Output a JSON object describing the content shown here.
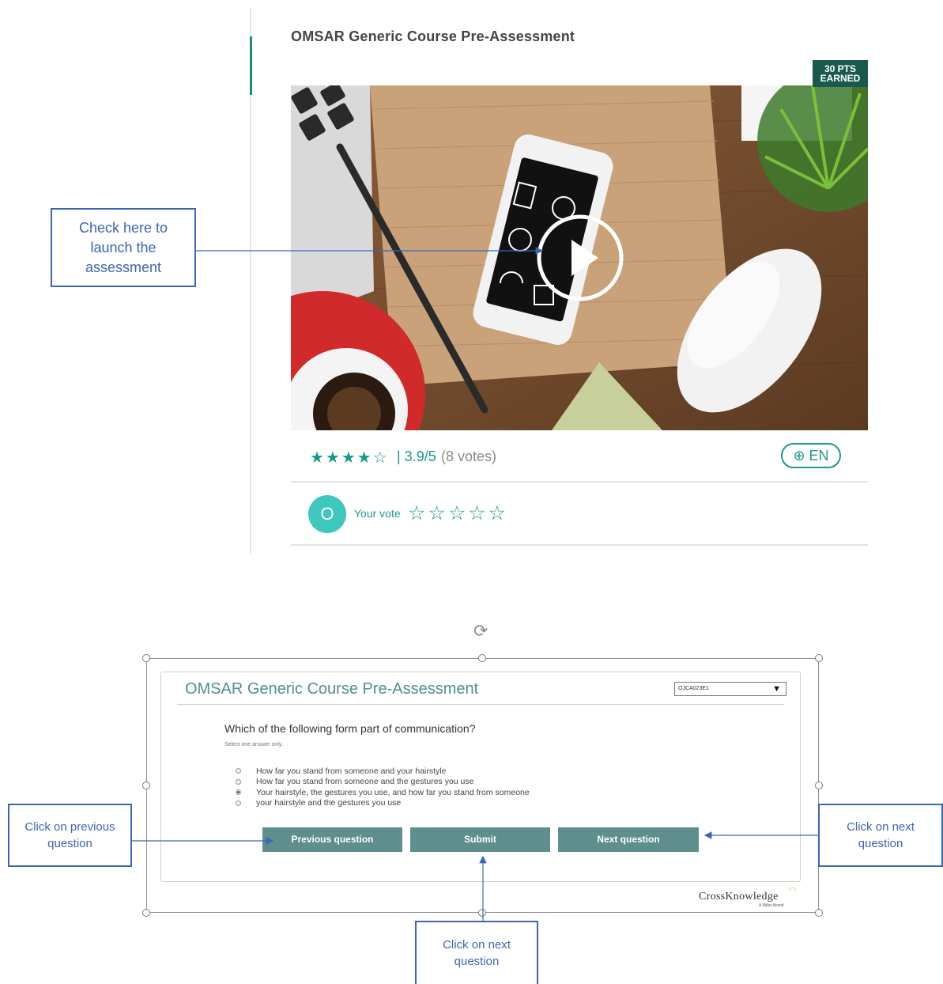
{
  "course_card": {
    "title": "OMSAR Generic Course Pre-Assessment",
    "points_line1": "30 PTS",
    "points_line2": "EARNED",
    "rating_stars": "★★★★☆",
    "rating_text": "| 3.9/5",
    "votes_text": "(8 votes)",
    "language": "EN",
    "avatar_initial": "O",
    "your_vote_label": "Your vote",
    "vote_stars": "☆☆☆☆☆"
  },
  "assessment": {
    "title": "OMSAR Generic Course Pre-Assessment",
    "language_select_value": "OJCA023E1",
    "question": "Which of the following form part of communication?",
    "instruction": "Select one answer only.",
    "options": [
      {
        "label": "How far you stand from someone and your hairstyle",
        "selected": false
      },
      {
        "label": "How far you stand from someone and the gestures you use",
        "selected": false
      },
      {
        "label": "Your hairstyle, the gestures you use, and how far you stand from someone",
        "selected": true
      },
      {
        "label": "your hairstyle and the gestures you use",
        "selected": false
      }
    ],
    "buttons": {
      "previous": "Previous question",
      "submit": "Submit",
      "next": "Next question"
    },
    "logo_text": "CrossKnowledge",
    "logo_sub": "A Wiley Brand"
  },
  "callouts": {
    "launch": [
      "Check here to",
      "launch the",
      "assessment"
    ],
    "previous": [
      "Click on previous",
      "question"
    ],
    "next": [
      "Click on next",
      "question"
    ],
    "submit": [
      "Click on next",
      "question"
    ]
  },
  "colors": {
    "accent": "#1f9a8a",
    "button": "#5e8f8d",
    "callout": "#3a66b6",
    "badge": "#1a5a4e"
  }
}
